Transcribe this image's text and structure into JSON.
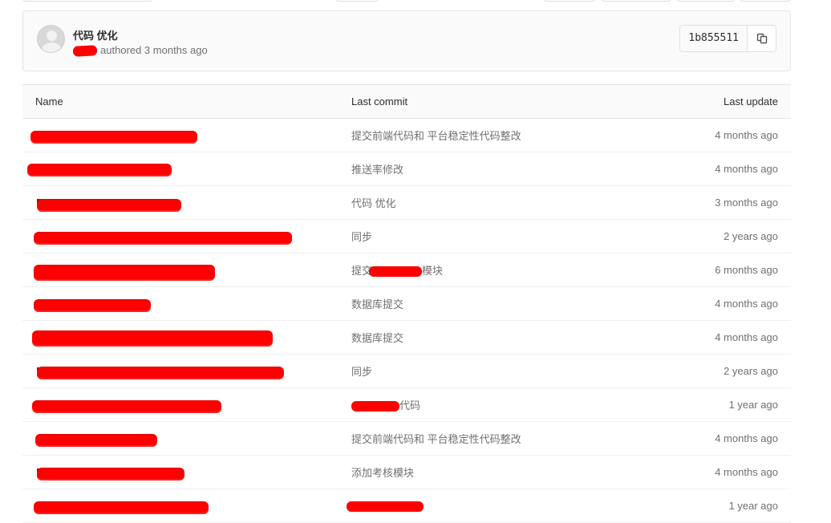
{
  "commit": {
    "title": "代码 优化",
    "meta": "authored 3 months ago",
    "sha": "1b855511",
    "copy_icon": "copy-icon"
  },
  "tree": {
    "headers": {
      "name": "Name",
      "last_commit": "Last commit",
      "last_update": "Last update"
    },
    "rows": [
      {
        "message": "提交前端代码和 平台稳定性代码整改",
        "updated": "4 months ago"
      },
      {
        "message": "推送率修改",
        "updated": "4 months ago"
      },
      {
        "message": "代码 优化",
        "updated": "3 months ago"
      },
      {
        "message": "同步",
        "updated": "2 years ago"
      },
      {
        "message_pre": "提交",
        "message_post": "模块",
        "updated": "6 months ago"
      },
      {
        "message": "数据库提交",
        "updated": "4 months ago"
      },
      {
        "message": "数据库提交",
        "updated": "4 months ago"
      },
      {
        "message": "同步",
        "updated": "2 years ago"
      },
      {
        "message_post": "代码",
        "updated": "1 year ago"
      },
      {
        "message": "提交前端代码和 平台稳定性代码整改",
        "updated": "4 months ago"
      },
      {
        "message": "添加考核模块",
        "updated": "4 months ago"
      },
      {
        "message": "",
        "updated": "1 year ago"
      }
    ]
  },
  "colors": {
    "redaction": "#ff0000",
    "muted_text": "#707070"
  }
}
